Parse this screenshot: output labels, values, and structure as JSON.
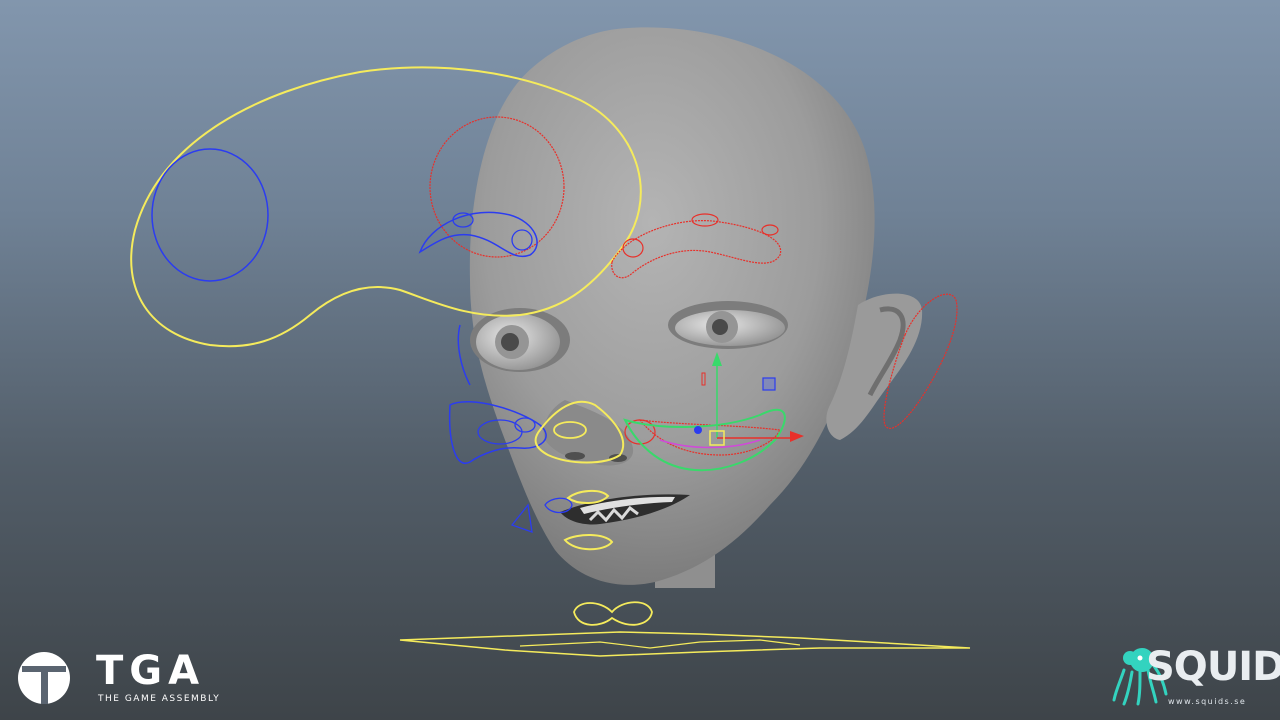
{
  "viewport": {
    "background_top": "#8296ad",
    "background_bottom": "#3e4449"
  },
  "scene": {
    "model": "stylized child head mesh",
    "control_curve_colors": {
      "yellow": "#f5eb5c",
      "blue": "#2b3cf0",
      "red": "#e8302a",
      "green": "#39d96b",
      "magenta": "#d04ad8"
    }
  },
  "branding": {
    "tga": {
      "logo_text": "TGA",
      "tagline": "THE GAME ASSEMBLY",
      "color": "#ffffff"
    },
    "squids": {
      "logo_text": "SQUIDS",
      "url": "www.squids.se",
      "mascot_color": "#33d3bf"
    }
  }
}
